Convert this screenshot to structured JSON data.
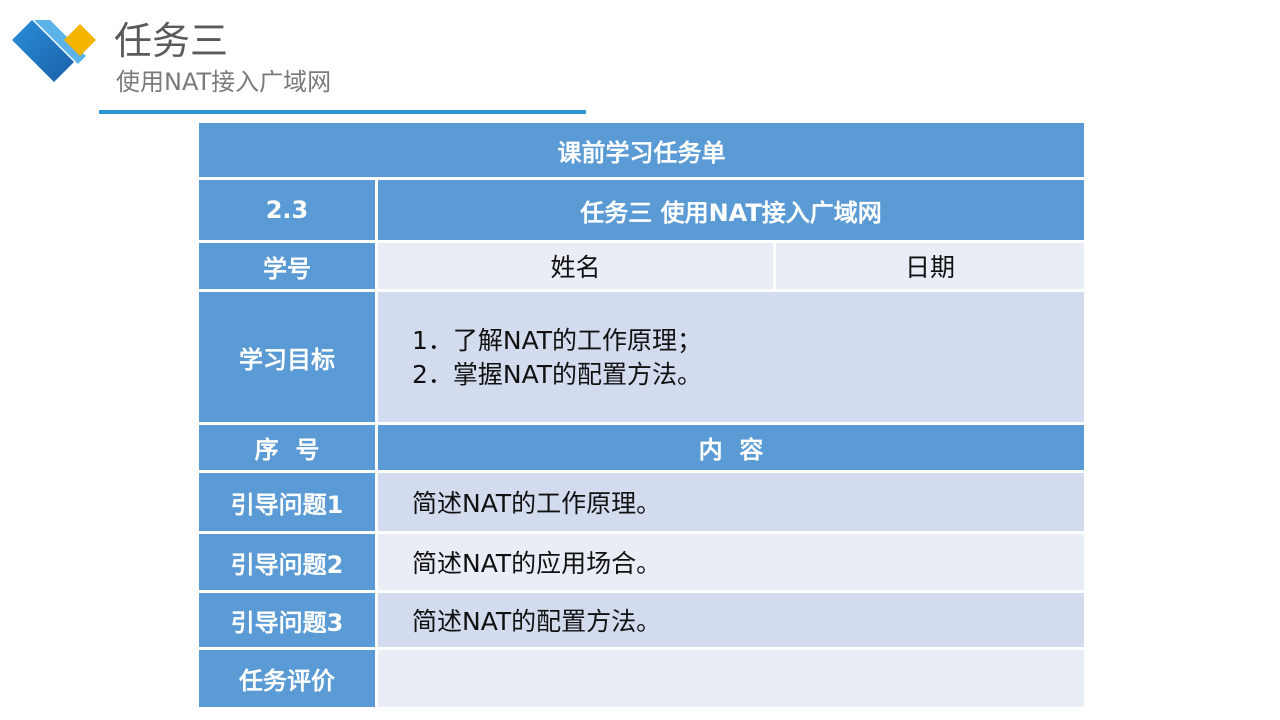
{
  "header": {
    "title": "任务三",
    "subtitle": "使用NAT接入广域网"
  },
  "table": {
    "title": "课前学习任务单",
    "section_no": "2.3",
    "section_title": "任务三 使用NAT接入广域网",
    "student_id_label": "学号",
    "name_label": "姓名",
    "date_label": "日期",
    "goal_label": "学习目标",
    "goals": [
      "1．了解NAT的工作原理；",
      "2．掌握NAT的配置方法。"
    ],
    "index_label": "序  号",
    "content_label": "内  容",
    "questions": [
      {
        "label": "引导问题1",
        "text": "简述NAT的工作原理。"
      },
      {
        "label": "引导问题2",
        "text": "简述NAT的应用场合。"
      },
      {
        "label": "引导问题3",
        "text": "简述NAT的配置方法。"
      }
    ],
    "evaluation_label": "任务评价",
    "evaluation_value": ""
  },
  "colors": {
    "header_blue": "#5b9bd5",
    "row_light": "#e9edf5",
    "row_mid": "#d2dcee",
    "rule_blue": "#2f96d6",
    "logo_gold": "#f5b400"
  }
}
